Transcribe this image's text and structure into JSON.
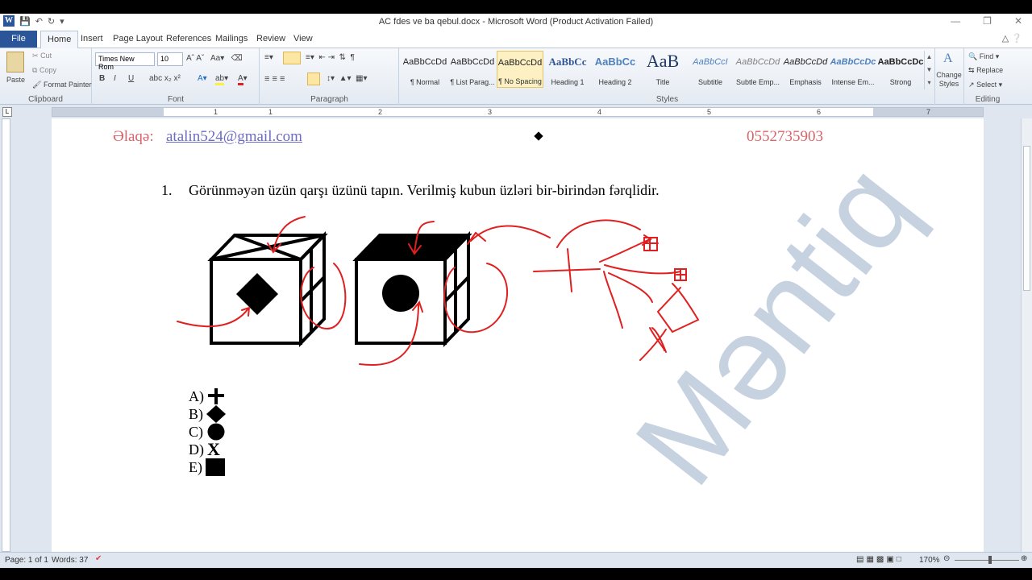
{
  "window": {
    "title": "AC fdes ve ba qebul.docx  -  Microsoft Word (Product Activation Failed)"
  },
  "tabs": [
    {
      "label": "File"
    },
    {
      "label": "Home"
    },
    {
      "label": "Insert"
    },
    {
      "label": "Page Layout"
    },
    {
      "label": "References"
    },
    {
      "label": "Mailings"
    },
    {
      "label": "Review"
    },
    {
      "label": "View"
    }
  ],
  "ribbon": {
    "clipboard": {
      "paste": "Paste",
      "cut": "Cut",
      "copy": "Copy",
      "format_painter": "Format Painter",
      "label": "Clipboard"
    },
    "font": {
      "name": "Times New Rom",
      "size": "10",
      "label": "Font"
    },
    "paragraph": {
      "label": "Paragraph"
    },
    "styles": {
      "label": "Styles",
      "items": [
        {
          "sample": "AaBbCcDd",
          "name": "¶ Normal"
        },
        {
          "sample": "AaBbCcDd",
          "name": "¶ List Parag..."
        },
        {
          "sample": "AaBbCcDd",
          "name": "¶ No Spacing"
        },
        {
          "sample": "AaBbCc",
          "name": "Heading 1"
        },
        {
          "sample": "AaBbCc",
          "name": "Heading 2"
        },
        {
          "sample": "AaB",
          "name": "Title"
        },
        {
          "sample": "AaBbCcI",
          "name": "Subtitle"
        },
        {
          "sample": "AaBbCcDd",
          "name": "Subtle Emp..."
        },
        {
          "sample": "AaBbCcDd",
          "name": "Emphasis"
        },
        {
          "sample": "AaBbCcDc",
          "name": "Intense Em..."
        },
        {
          "sample": "AaBbCcDc",
          "name": "Strong"
        }
      ],
      "change_styles": "Change Styles"
    },
    "editing": {
      "find": "Find",
      "replace": "Replace",
      "select": "Select",
      "label": "Editing"
    }
  },
  "ruler": {
    "numbers": [
      "1",
      "1",
      "2",
      "3",
      "4",
      "5",
      "6",
      "7"
    ]
  },
  "document": {
    "contact_label": "Əlaqə:",
    "contact_email": "atalin524@gmail.com",
    "contact_phone": "0552735903",
    "question_number": "1.",
    "question_text": "Görünməyən üzün qarşı üzünü tapın. Verilmiş kubun üzləri bir-birindən fərqlidir.",
    "options": [
      {
        "letter": "A)",
        "symbol": "plus"
      },
      {
        "letter": "B)",
        "symbol": "diamond"
      },
      {
        "letter": "C)",
        "symbol": "circle"
      },
      {
        "letter": "D)",
        "symbol": "X"
      },
      {
        "letter": "E)",
        "symbol": "square"
      }
    ],
    "watermark": "Məntiq"
  },
  "status": {
    "page": "Page: 1 of 1",
    "words": "Words: 37",
    "zoom": "170%"
  },
  "colors": {
    "file_tab": "#2a5599",
    "annotation_red": "#e02020",
    "contact_red": "#d9646a",
    "link_blue": "#6c6cc4"
  }
}
